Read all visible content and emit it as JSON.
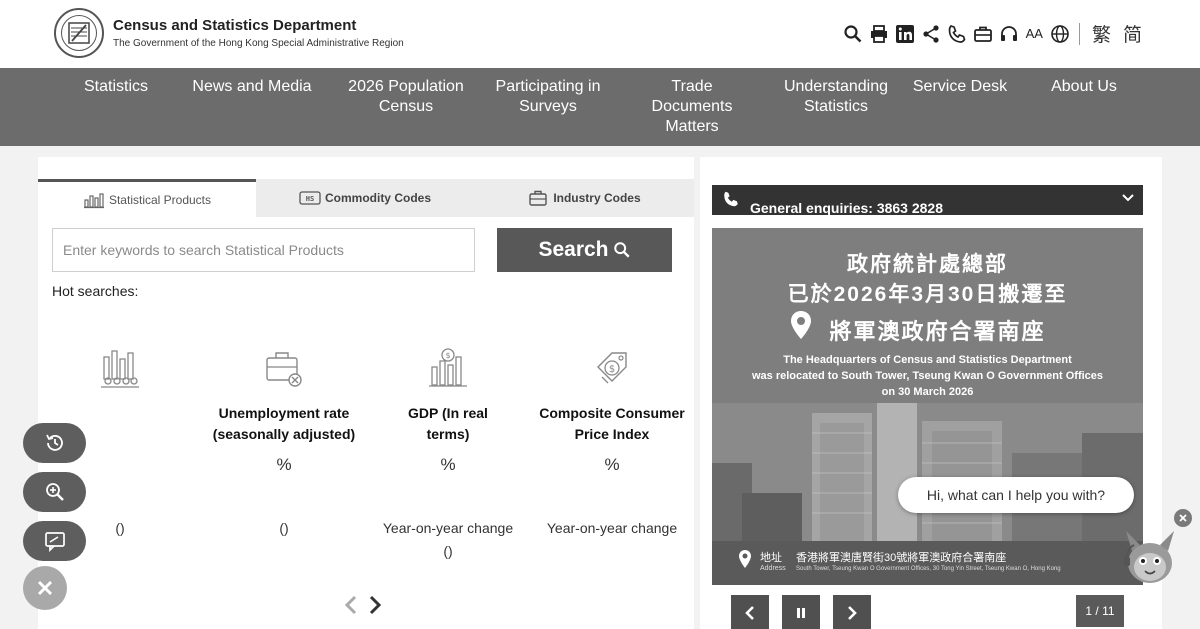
{
  "header": {
    "title": "Census and Statistics Department",
    "subtitle": "The Government of the Hong Kong Special Administrative Region",
    "tools": [
      "search-icon",
      "print-icon",
      "linkedin-icon",
      "share-icon",
      "phone-icon",
      "briefcase-icon",
      "headset-icon",
      "font-size-icon",
      "globe-icon"
    ],
    "font_size_label": "AA",
    "lang_traditional": "繁",
    "lang_simplified": "简"
  },
  "nav": {
    "items": [
      {
        "label": "Statistics"
      },
      {
        "label": "News and Media"
      },
      {
        "label": "2026 Population Census"
      },
      {
        "label": "Participating in Surveys"
      },
      {
        "label": "Trade Documents Matters"
      },
      {
        "label": "Understanding Statistics"
      },
      {
        "label": "Service Desk"
      },
      {
        "label": "About Us"
      }
    ]
  },
  "search": {
    "tabs": [
      {
        "label": "Statistical Products",
        "icon": "chart-icon",
        "active": true
      },
      {
        "label": "Commodity Codes",
        "icon": "code-icon",
        "active": false
      },
      {
        "label": "Industry Codes",
        "icon": "briefcase-icon",
        "active": false
      }
    ],
    "placeholder": "Enter keywords to search Statistical Products",
    "value": "",
    "button_label": "Search",
    "hot_label": "Hot searches:"
  },
  "indicators": [
    {
      "icon": "population-icon",
      "title": "",
      "unit": "",
      "note": "()"
    },
    {
      "icon": "briefcase-x-icon",
      "title": "Unemployment rate (seasonally adjusted)",
      "unit": "%",
      "note": "()"
    },
    {
      "icon": "bar-chart-dollar-icon",
      "title": "GDP (In real terms)",
      "unit": "%",
      "note": "Year-on-year change",
      "note2": "()"
    },
    {
      "icon": "price-tag-dollar-icon",
      "title": "Composite Consumer Price Index",
      "unit": "%",
      "note": "Year-on-year change"
    }
  ],
  "enquiry": {
    "label": "General enquiries: 3863 2828"
  },
  "banner": {
    "cn_line1": "政府統計處總部",
    "cn_line2": "已於2026年3月30日搬遷至",
    "cn_line3": "將軍澳政府合署南座",
    "en_line1": "The Headquarters of Census and Statistics Department",
    "en_line2": "was relocated to South Tower, Tseung Kwan O Government Offices",
    "en_line3": "on 30 March 2026",
    "addr_label": "地址",
    "addr_sublabel": "Address",
    "addr_cn": "香港將軍澳唐賢街30號將軍澳政府合署南座",
    "addr_en": "South Tower, Tseung Kwan O Government Offices, 30 Tong Yin Street, Tseung Kwan O, Hong Kong"
  },
  "slider": {
    "counter": "1 / 11"
  },
  "chat": {
    "bubble": "Hi, what can I help you with?"
  }
}
